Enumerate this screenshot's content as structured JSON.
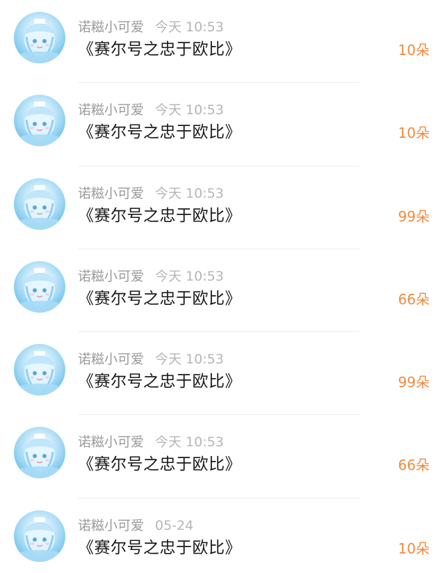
{
  "gift_list": {
    "items": [
      {
        "username": "诺糍小可爱",
        "time": "今天 10:53",
        "title": "《赛尔号之忠于欧比》",
        "amount": "10朵",
        "avatar_icon": "anime-avatar-icon"
      },
      {
        "username": "诺糍小可爱",
        "time": "今天 10:53",
        "title": "《赛尔号之忠于欧比》",
        "amount": "10朵",
        "avatar_icon": "anime-avatar-icon"
      },
      {
        "username": "诺糍小可爱",
        "time": "今天 10:53",
        "title": "《赛尔号之忠于欧比》",
        "amount": "99朵",
        "avatar_icon": "anime-avatar-icon"
      },
      {
        "username": "诺糍小可爱",
        "time": "今天 10:53",
        "title": "《赛尔号之忠于欧比》",
        "amount": "66朵",
        "avatar_icon": "anime-avatar-icon"
      },
      {
        "username": "诺糍小可爱",
        "time": "今天 10:53",
        "title": "《赛尔号之忠于欧比》",
        "amount": "99朵",
        "avatar_icon": "anime-avatar-icon"
      },
      {
        "username": "诺糍小可爱",
        "time": "今天 10:53",
        "title": "《赛尔号之忠于欧比》",
        "amount": "66朵",
        "avatar_icon": "anime-avatar-icon"
      },
      {
        "username": "诺糍小可爱",
        "time": "05-24",
        "title": "《赛尔号之忠于欧比》",
        "amount": "10朵",
        "avatar_icon": "anime-avatar-icon"
      }
    ]
  },
  "colors": {
    "amount": "#f08a3e",
    "username": "#9a9a9a",
    "time": "#b5b5b5",
    "title": "#1a1a1a",
    "divider": "#ececec"
  }
}
